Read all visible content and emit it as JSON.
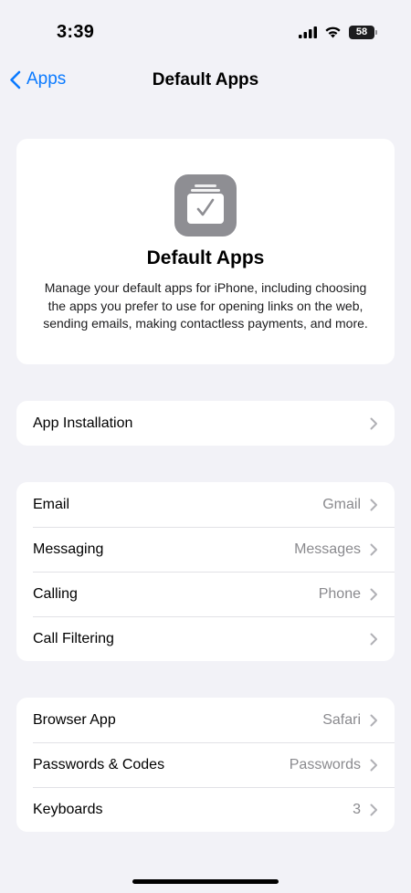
{
  "status": {
    "time": "3:39",
    "battery": "58"
  },
  "nav": {
    "back_label": "Apps",
    "title": "Default Apps"
  },
  "hero": {
    "title": "Default Apps",
    "description": "Manage your default apps for iPhone, including choosing the apps you prefer to use for opening links on the web, sending emails, making contactless payments, and more."
  },
  "groups": [
    {
      "rows": [
        {
          "label": "App Installation",
          "value": ""
        }
      ]
    },
    {
      "rows": [
        {
          "label": "Email",
          "value": "Gmail"
        },
        {
          "label": "Messaging",
          "value": "Messages"
        },
        {
          "label": "Calling",
          "value": "Phone"
        },
        {
          "label": "Call Filtering",
          "value": ""
        }
      ]
    },
    {
      "rows": [
        {
          "label": "Browser App",
          "value": "Safari"
        },
        {
          "label": "Passwords & Codes",
          "value": "Passwords"
        },
        {
          "label": "Keyboards",
          "value": "3"
        }
      ]
    }
  ],
  "colors": {
    "accent": "#0a7aff",
    "background": "#f2f2f7",
    "secondary_text": "#8a8a8e"
  }
}
